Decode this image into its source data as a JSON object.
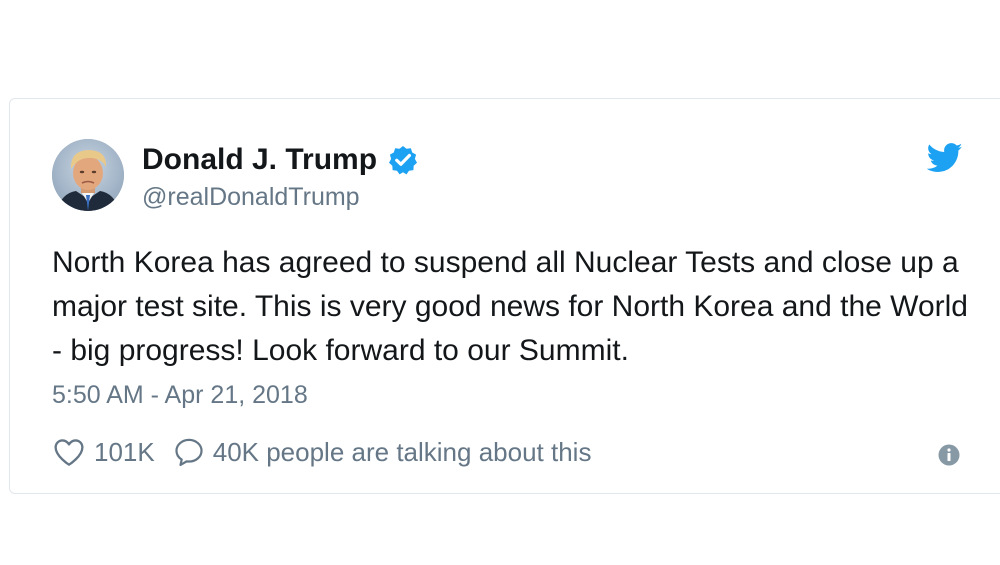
{
  "tweet": {
    "author": {
      "display_name": "Donald J. Trump",
      "handle": "@realDonaldTrump",
      "verified": true,
      "avatar_icon": "profile-photo"
    },
    "text": "North Korea has agreed to suspend all Nuclear Tests and close up a major test site. This is very good news for North Korea and the World - big progress! Look forward to our Summit.",
    "timestamp": "5:50 AM - Apr 21, 2018",
    "likes": "101K",
    "talking": "40K people are talking about this"
  },
  "icons": {
    "brand": "twitter-bird-icon",
    "verified": "verified-badge-icon",
    "like": "heart-icon",
    "reply": "speech-bubble-icon",
    "info": "info-icon"
  },
  "colors": {
    "brand_blue": "#1da1f2",
    "text_primary": "#14171a",
    "text_secondary": "#657786",
    "border": "#e1e8ed"
  }
}
